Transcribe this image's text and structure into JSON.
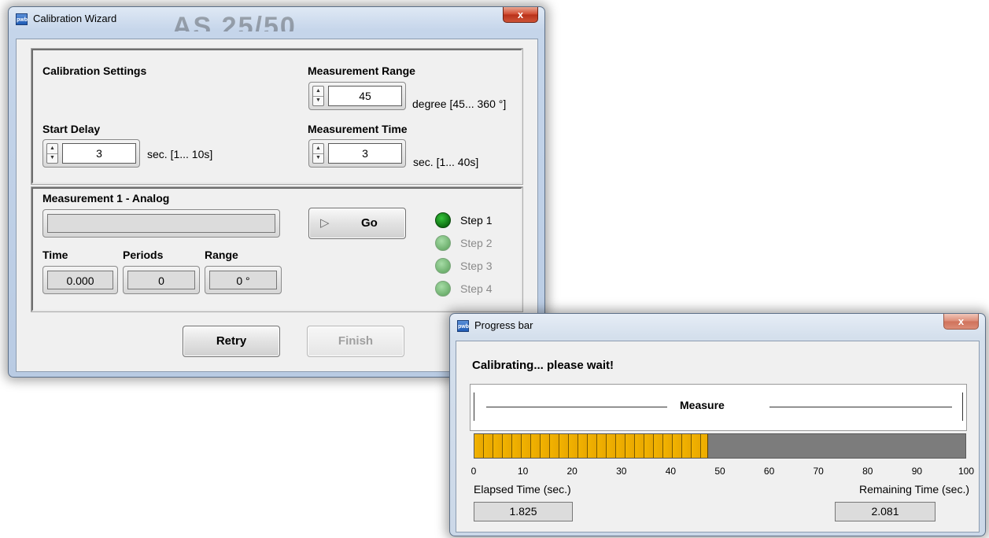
{
  "calibration_window": {
    "title": "Calibration Wizard",
    "close_glyph": "x",
    "background_text": "AS 25/50",
    "settings": {
      "heading": "Calibration Settings",
      "start_delay": {
        "label": "Start Delay",
        "value": "3",
        "unit": "sec. [1... 10s]"
      },
      "measurement_range": {
        "label": "Measurement Range",
        "value": "45",
        "unit": "degree [45... 360 °]"
      },
      "measurement_time": {
        "label": "Measurement Time",
        "value": "3",
        "unit": "sec. [1... 40s]"
      }
    },
    "measurement": {
      "heading": "Measurement 1 - Analog",
      "go_label": "Go",
      "go_icon": "play-triangle-icon",
      "time": {
        "label": "Time",
        "value": "0.000"
      },
      "periods": {
        "label": "Periods",
        "value": "0"
      },
      "range": {
        "label": "Range",
        "value": "0 °"
      },
      "steps": [
        {
          "label": "Step 1",
          "active": true
        },
        {
          "label": "Step 2",
          "active": false
        },
        {
          "label": "Step 3",
          "active": false
        },
        {
          "label": "Step 4",
          "active": false
        }
      ]
    },
    "retry_label": "Retry",
    "finish_label": "Finish"
  },
  "progress_window": {
    "title": "Progress bar",
    "close_glyph": "x",
    "message": "Calibrating... please wait!",
    "phase_label": "Measure",
    "progress_percent": 47.5,
    "scale_ticks": [
      "0",
      "10",
      "20",
      "30",
      "40",
      "50",
      "60",
      "70",
      "80",
      "90",
      "100"
    ],
    "elapsed": {
      "label": "Elapsed Time (sec.)",
      "value": "1.825"
    },
    "remaining": {
      "label": "Remaining Time (sec.)",
      "value": "2.081"
    }
  },
  "colors": {
    "progress_fill": "#f2b300",
    "progress_track": "#7c7c7c",
    "led_on": "#1a8a1e",
    "led_off": "#7fc07f",
    "close_button": "#c9442a"
  }
}
